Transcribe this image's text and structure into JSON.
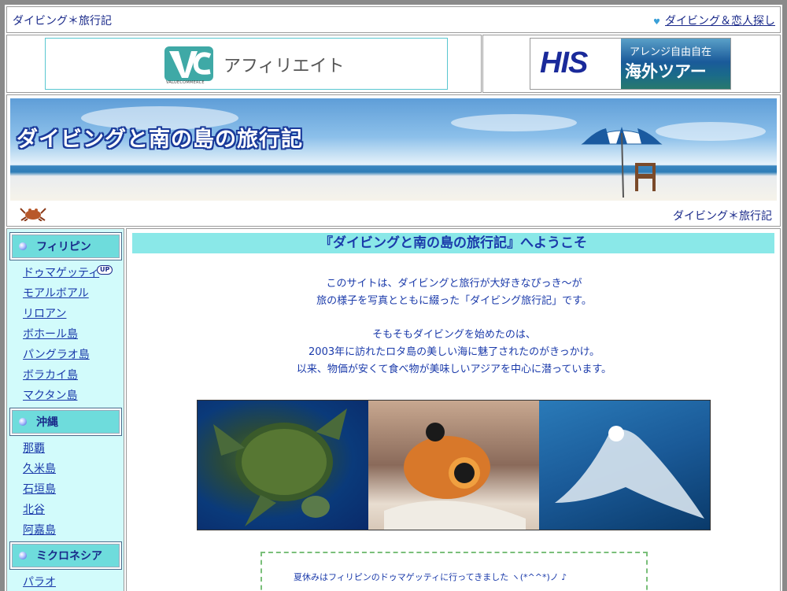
{
  "topbar": {
    "site_title": "ダイビング＊旅行記",
    "right_link": "ダイビング＆恋人探し",
    "heart_icon": "heart-icon"
  },
  "ads": {
    "left": {
      "brand": "アフィリエイト",
      "small": "VALUECOMMERCE"
    },
    "right": {
      "logo": "HIS",
      "line1": "アレンジ自由自在",
      "line2": "海外ツアー"
    }
  },
  "header": {
    "title": "ダイビングと南の島の旅行記",
    "link": "ダイビング＊旅行記",
    "crab_icon": "crab-icon"
  },
  "sidebar": {
    "categories": [
      {
        "label": "フィリピン",
        "items": [
          "ドゥマゲッティ",
          "モアルボアル",
          "リロアン",
          "ボホール島",
          "パングラオ島",
          "ボラカイ島",
          "マクタン島"
        ]
      },
      {
        "label": "沖縄",
        "items": [
          "那覇",
          "久米島",
          "石垣島",
          "北谷",
          "阿嘉島"
        ]
      },
      {
        "label": "ミクロネシア",
        "items": [
          "パラオ"
        ]
      }
    ],
    "up_badge": "UP"
  },
  "main": {
    "welcome": "『ダイビングと南の島の旅行記』へようこそ",
    "para1": [
      "このサイトは、ダイビングと旅行が大好きなぴっき～が",
      "旅の様子を写真とともに綴った「ダイビング旅行記」です。"
    ],
    "para2": [
      "そもそもダイビングを始めたのは、",
      "2003年に訪れたロタ島の美しい海に魅了されたのがきっかけ。",
      "以来、物価が安くて食べ物が美味しいアジアを中心に潜っています。"
    ],
    "photos": [
      "turtle-photo",
      "goby-fish-photo",
      "manta-ray-photo"
    ],
    "news": "夏休みはフィリピンのドゥマゲッティに行ってきました ヽ(*^^*)ノ ♪"
  },
  "colors": {
    "text": "#1a2a8a",
    "sidebar_bg": "#d2fbfb",
    "heading_bg": "#8ae8e8",
    "category_bg": "#6edcdc"
  }
}
